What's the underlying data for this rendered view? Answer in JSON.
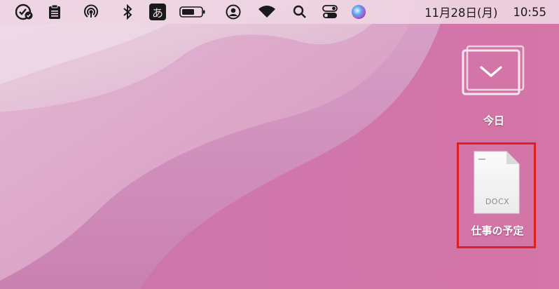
{
  "menubar": {
    "icons": [
      "checklist-badge-icon",
      "clipboard-icon",
      "airdrop-icon",
      "bluetooth-icon",
      "input-method-icon",
      "battery-icon",
      "user-account-icon",
      "wifi-icon",
      "search-icon",
      "control-center-icon",
      "siri-icon"
    ],
    "input_method_label": "あ",
    "date": "11月28日(月)",
    "time": "10:55"
  },
  "desktop": {
    "stack": {
      "label": "今日",
      "icon": "stack-folder-icon"
    },
    "file": {
      "label": "仕事の予定",
      "extension": "DOCX",
      "icon": "docx-file-icon",
      "selected": true
    },
    "colors": {
      "selection_outline": "#e02020",
      "label_text": "#ffffff"
    }
  }
}
